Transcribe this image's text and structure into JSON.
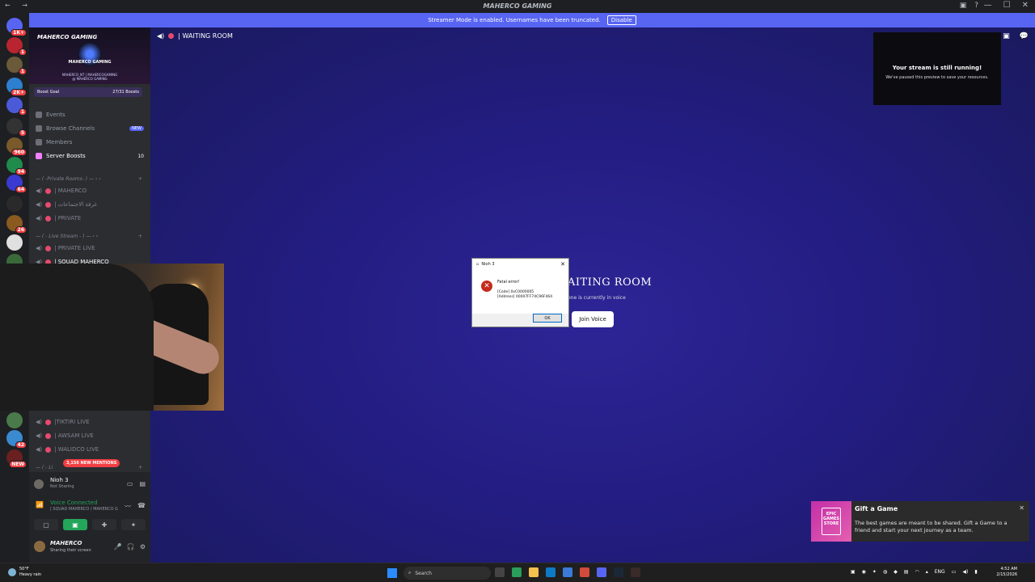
{
  "window": {
    "title": "MAHERCO GAMING",
    "nav_symbols": "← →"
  },
  "titlebar_icons": [
    "inbox-icon",
    "help-icon"
  ],
  "window_controls": [
    "—",
    "☐",
    "✕"
  ],
  "banner": {
    "text": "Streamer Mode is enabled. Usernames have been truncated.",
    "button": "Disable"
  },
  "guild_badges": [
    "1K+",
    "1",
    "1",
    "2K+",
    "1",
    "5",
    "960",
    "94",
    "64",
    "26",
    "",
    "",
    "",
    "",
    "42",
    "NEW"
  ],
  "server": {
    "name": "MAHERCO GAMING",
    "art_title": "MAHERCO GAMING",
    "art_sub": "MAHERCO_NT | MAHERCOGAMING  @ MAHERCO GAMING",
    "boost_goal": "Boost Goal",
    "boost_count": "27/31 Boosts"
  },
  "nav": {
    "events": "Events",
    "browse": "Browse Channels",
    "browse_pill": "NEW",
    "members": "Members",
    "boosts": "Server Boosts",
    "boosts_count": "10"
  },
  "categories": {
    "private": "— ( -Private Rooms- ) — ‹ ‹",
    "live": "— ( - Live Stream - ) — ‹ ‹",
    "live2": "— ( - Li"
  },
  "channels": {
    "maherco": "| MAHERCO",
    "arabic": "| غرفة الاجتماعات",
    "private": "| PRIVATE",
    "private_live": "| PRIVATE LIVE",
    "squad": "| SQUAD MAHERCO",
    "tiktiri": "|TIKTIRI LIVE",
    "awsam": "| AWSAM LIVE",
    "walidco": "| WALIDCO LIVE"
  },
  "mentions": "3,156 NEW MENTIONS",
  "activity": {
    "game": "Nioh 3",
    "status": "Not Sharing"
  },
  "voice": {
    "title": "Voice Connected",
    "channel": "| SQUAD MAHERCO / MAHERCO GA..."
  },
  "user": {
    "name": "MAHERCO",
    "status": "Sharing their screen"
  },
  "main": {
    "channel": "| WAITING ROOM",
    "stream_title": "Your stream is still running!",
    "stream_sub": "We've paused this preview to save your resources.",
    "center_title": "AITING ROOM",
    "center_sub": "one is currently in voice",
    "join": "Join Voice"
  },
  "dialog": {
    "title": "Nioh 3",
    "line1": "Fatal error!",
    "line2": "[Code] 0xC0000005",
    "line3": "[Address] 00007FF74C96F464",
    "ok": "OK"
  },
  "toast": {
    "title": "Gift a Game",
    "body": "The best games are meant to be shared. Gift a Game to a friend and start your next journey as a team.",
    "logo": "EPIC GAMES STORE"
  },
  "taskbar": {
    "temp": "50°F",
    "weather": "Heavy rain",
    "search": "Search",
    "lang": "ENG",
    "time": "4:52 AM",
    "date": "2/15/2026"
  }
}
